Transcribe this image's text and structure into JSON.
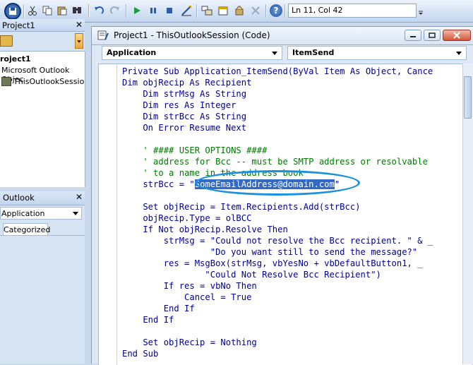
{
  "toolbar": {
    "position_text": "Ln 11, Col 42",
    "icons": [
      "save-icon",
      "cut-icon",
      "copy-icon",
      "paste-icon",
      "find-icon",
      "undo-icon",
      "redo-icon",
      "run-icon",
      "break-icon",
      "reset-icon",
      "design-mode-icon",
      "project-explorer-icon",
      "properties-icon",
      "object-browser-icon",
      "toolbox-icon",
      "help-icon"
    ]
  },
  "project_panel": {
    "title": "Project1",
    "tree": [
      {
        "label": "roject1",
        "bold": true
      },
      {
        "label": "Microsoft Outlook Objec",
        "bold": false
      },
      {
        "label": "ThisOutlookSession",
        "bold": false
      }
    ]
  },
  "properties_panel": {
    "title": "Outlook",
    "object_combo": "Application",
    "tab_categorized": "Categorized"
  },
  "code_window": {
    "title": "Project1 - ThisOutlookSession (Code)",
    "object_combo": "Application",
    "procedure_combo": "ItemSend",
    "lines": [
      [
        {
          "t": "Private Sub Application_ItemSend(ByVal Item As Object, Cance",
          "c": "kw"
        }
      ],
      [
        {
          "t": "Dim objRecip As Recipient",
          "c": "kw"
        }
      ],
      [
        {
          "t": "    Dim strMsg As String",
          "c": "kw"
        }
      ],
      [
        {
          "t": "    Dim res As Integer",
          "c": "kw"
        }
      ],
      [
        {
          "t": "    Dim strBcc As String",
          "c": "kw"
        }
      ],
      [
        {
          "t": "    On Error Resume Next",
          "c": "kw"
        }
      ],
      [
        {
          "t": "",
          "c": "tx"
        }
      ],
      [
        {
          "t": "    ' #### USER OPTIONS ####",
          "c": "cm"
        }
      ],
      [
        {
          "t": "    ' address for Bcc -- must be SMTP address or resolvable",
          "c": "cm"
        }
      ],
      [
        {
          "t": "    ' to a name in the address book",
          "c": "cm"
        }
      ],
      [
        {
          "t": "    strBcc = \"",
          "c": "kw"
        },
        {
          "t": "SomeEmailAddress@domain.com",
          "c": "hl"
        },
        {
          "t": "\"",
          "c": "kw"
        }
      ],
      [
        {
          "t": "",
          "c": "tx"
        }
      ],
      [
        {
          "t": "    Set objRecip = Item.Recipients.Add(strBcc)",
          "c": "kw"
        }
      ],
      [
        {
          "t": "    objRecip.Type = olBCC",
          "c": "kw"
        }
      ],
      [
        {
          "t": "    If Not objRecip.Resolve Then",
          "c": "kw"
        }
      ],
      [
        {
          "t": "        strMsg = \"Could not resolve the Bcc recipient. \" & _",
          "c": "kw"
        }
      ],
      [
        {
          "t": "                 \"Do you want still to send the message?\"",
          "c": "kw"
        }
      ],
      [
        {
          "t": "        res = MsgBox(strMsg, vbYesNo + vbDefaultButton1, _",
          "c": "kw"
        }
      ],
      [
        {
          "t": "                \"Could Not Resolve Bcc Recipient\")",
          "c": "kw"
        }
      ],
      [
        {
          "t": "        If res = vbNo Then",
          "c": "kw"
        }
      ],
      [
        {
          "t": "            Cancel = True",
          "c": "kw"
        }
      ],
      [
        {
          "t": "        End If",
          "c": "kw"
        }
      ],
      [
        {
          "t": "    End If",
          "c": "kw"
        }
      ],
      [
        {
          "t": "",
          "c": "tx"
        }
      ],
      [
        {
          "t": "    Set objRecip = Nothing",
          "c": "kw"
        }
      ],
      [
        {
          "t": "End Sub",
          "c": "kw"
        }
      ]
    ]
  },
  "colors": {
    "keyword": "#00008b",
    "comment": "#007a00",
    "selection": "#316ac5",
    "callout": "#1a90e0"
  }
}
